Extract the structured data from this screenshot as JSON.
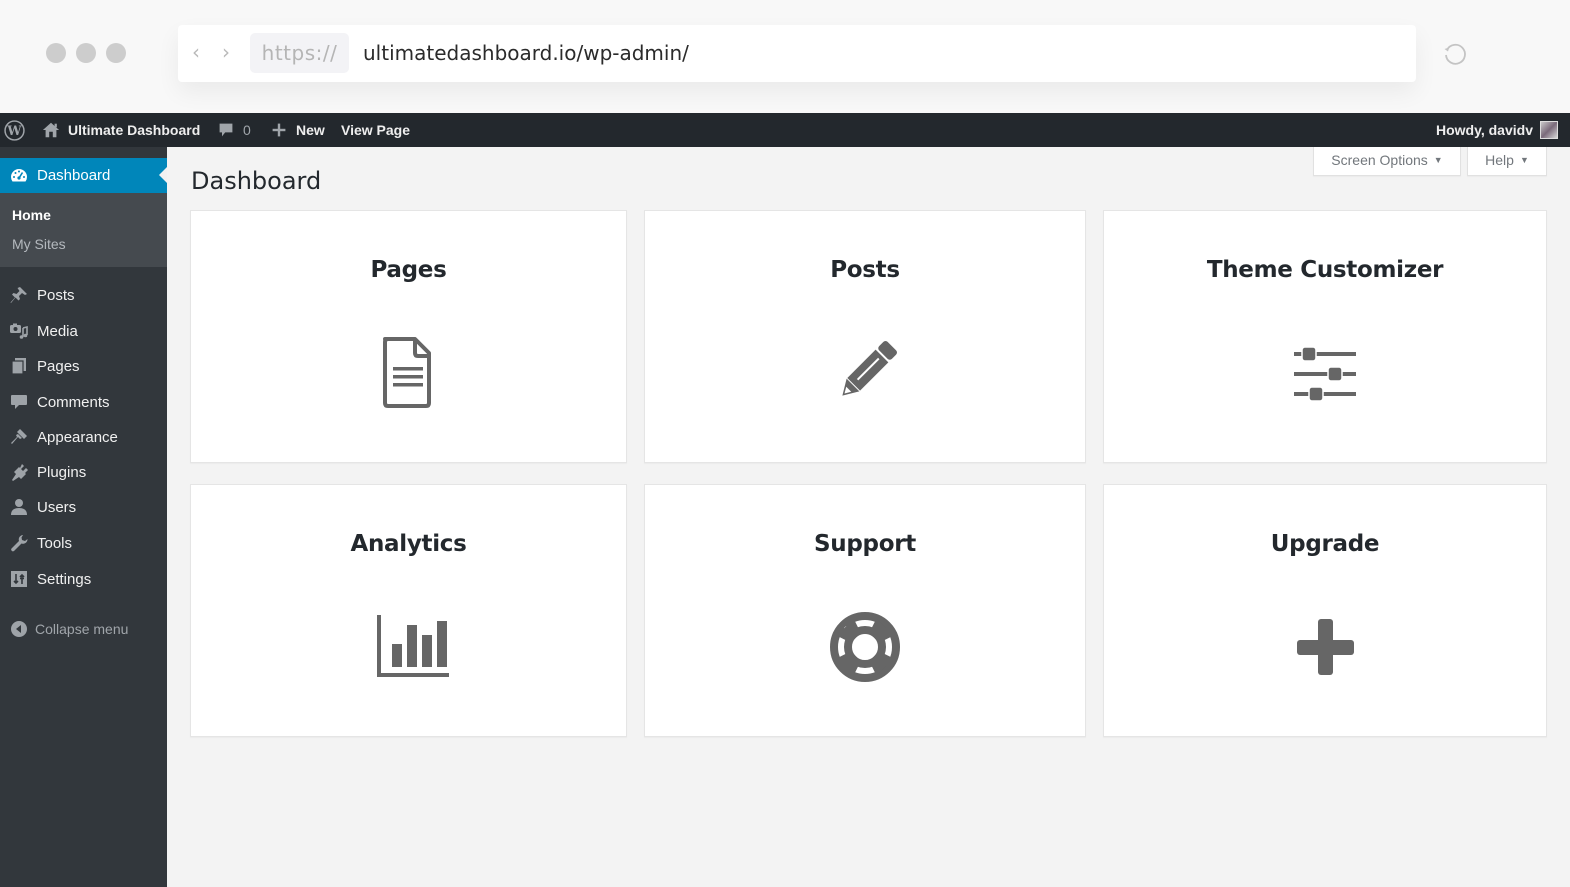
{
  "browser": {
    "protocol": "https://",
    "url": "ultimatedashboard.io/wp-admin/"
  },
  "adminbar": {
    "site_name": "Ultimate Dashboard",
    "comments_count": "0",
    "new_label": "New",
    "view_page_label": "View Page",
    "howdy": "Howdy, davidv"
  },
  "sidebar": {
    "active": {
      "label": "Dashboard",
      "icon": "dashboard-icon"
    },
    "submenu": [
      {
        "label": "Home",
        "current": true
      },
      {
        "label": "My Sites",
        "current": false
      }
    ],
    "items": [
      {
        "label": "Posts",
        "icon": "pin-icon"
      },
      {
        "label": "Media",
        "icon": "media-icon"
      },
      {
        "label": "Pages",
        "icon": "pages-icon"
      },
      {
        "label": "Comments",
        "icon": "comment-icon"
      },
      {
        "label": "Appearance",
        "icon": "brush-icon"
      },
      {
        "label": "Plugins",
        "icon": "plugin-icon"
      },
      {
        "label": "Users",
        "icon": "user-icon"
      },
      {
        "label": "Tools",
        "icon": "wrench-icon"
      },
      {
        "label": "Settings",
        "icon": "settings-icon"
      }
    ],
    "collapse_label": "Collapse menu"
  },
  "main": {
    "title": "Dashboard",
    "screen_options_label": "Screen Options",
    "help_label": "Help",
    "cards": [
      {
        "title": "Pages",
        "icon": "document-icon"
      },
      {
        "title": "Posts",
        "icon": "pencil-icon"
      },
      {
        "title": "Theme Customizer",
        "icon": "sliders-icon"
      },
      {
        "title": "Analytics",
        "icon": "bar-chart-icon"
      },
      {
        "title": "Support",
        "icon": "lifebuoy-icon"
      },
      {
        "title": "Upgrade",
        "icon": "plus-icon"
      }
    ]
  },
  "colors": {
    "adminbar_bg": "#23282d",
    "sidebar_bg": "#32373c",
    "submenu_bg": "#454a4f",
    "accent": "#0086ba",
    "icon_gray": "#666666",
    "content_bg": "#f3f3f3"
  }
}
